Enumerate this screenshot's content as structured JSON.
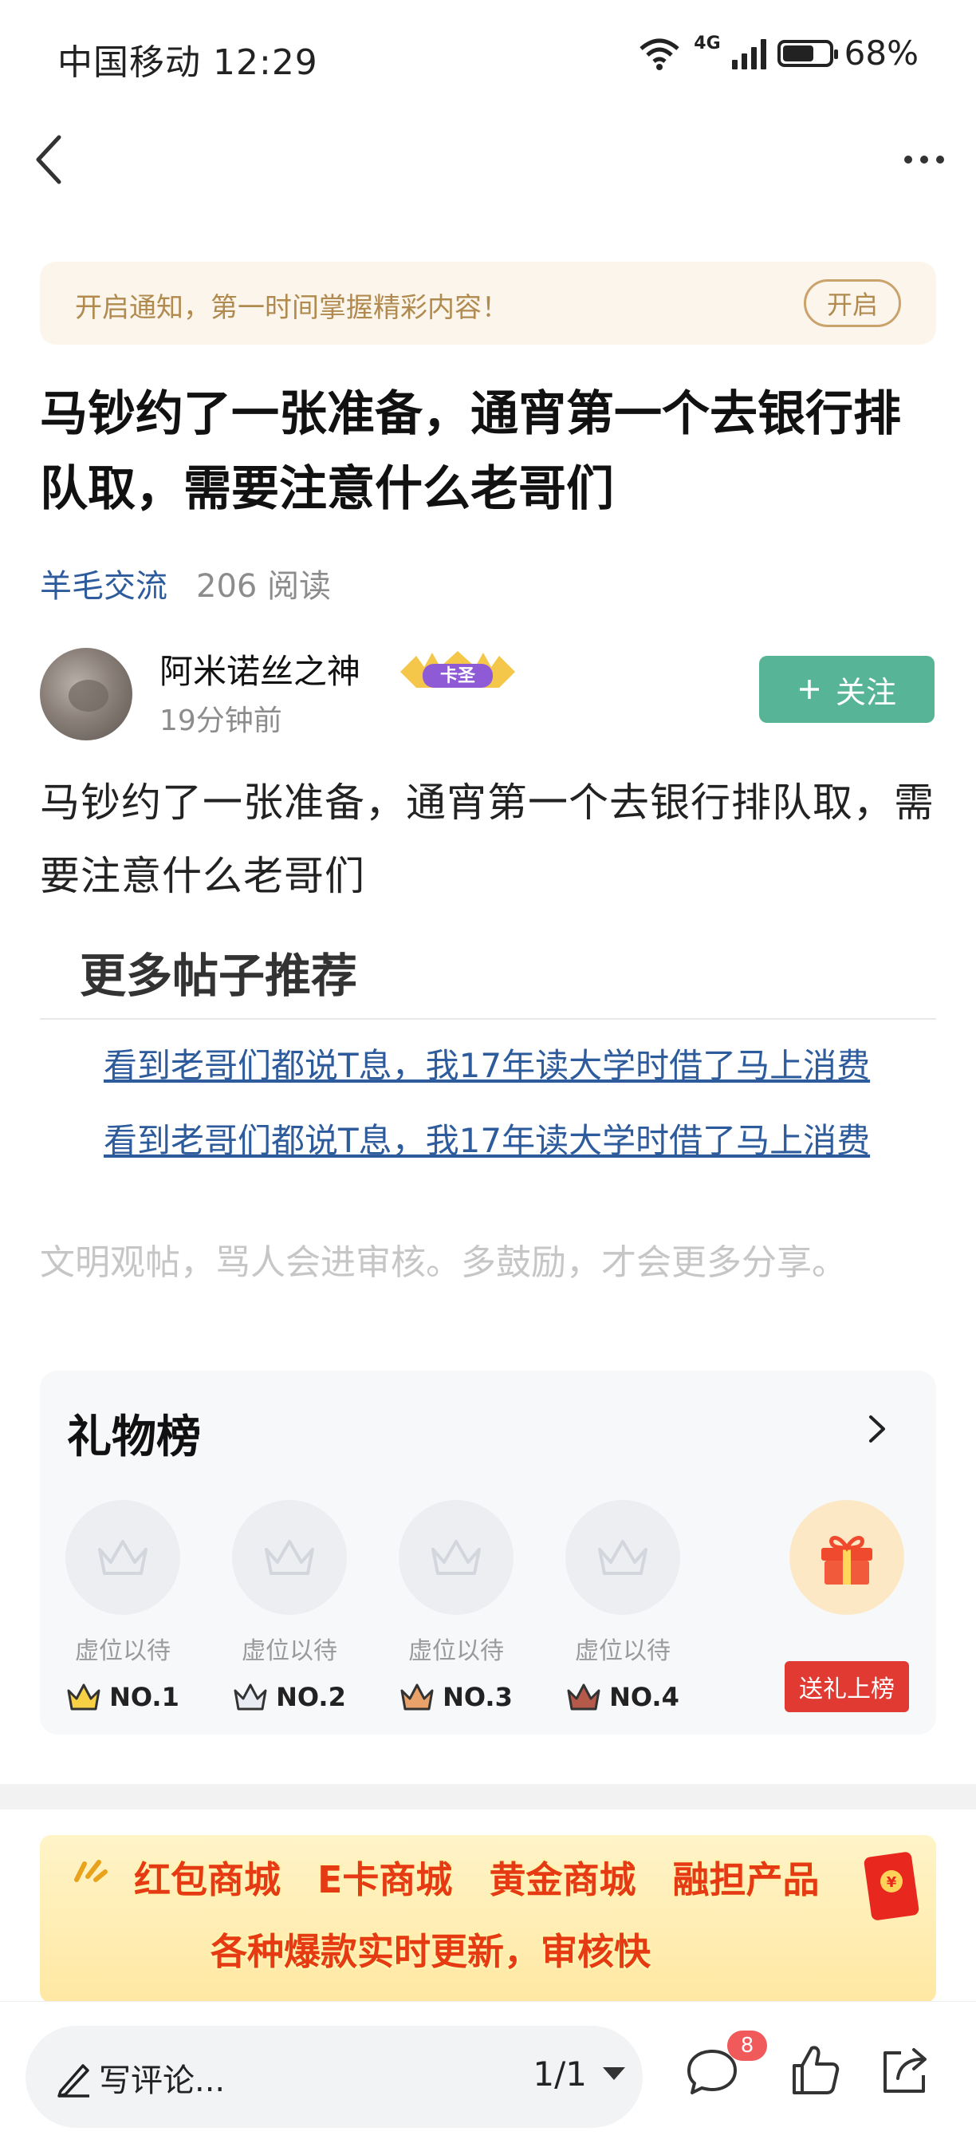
{
  "status_bar": {
    "carrier": "中国移动",
    "time": "12:29",
    "network": "4G",
    "battery": "68%",
    "battery_level": 0.68
  },
  "nav": {
    "back_icon": "chevron-left-icon",
    "more_icon": "more-dots-icon"
  },
  "notice": {
    "text": "开启通知，第一时间掌握精彩内容！",
    "button": "开启"
  },
  "post": {
    "title": "马钞约了一张准备，通宵第一个去银行排队取，需要注意什么老哥们",
    "category": "羊毛交流",
    "reads": "206 阅读",
    "author": {
      "name": "阿米诺丝之神",
      "badge": "卡圣",
      "time": "19分钟前"
    },
    "follow_label": "关注",
    "body": "马钞约了一张准备，通宵第一个去银行排队取，需要注意什么老哥们"
  },
  "recommend": {
    "title": "更多帖子推荐",
    "links": [
      "看到老哥们都说T息，我17年读大学时借了马上消费",
      "看到老哥们都说T息，我17年读大学时借了马上消费"
    ]
  },
  "civility_note": "文明观帖，骂人会进审核。多鼓励，才会更多分享。",
  "gift_board": {
    "title": "礼物榜",
    "slots": [
      {
        "label": "虚位以待",
        "rank": "NO.1"
      },
      {
        "label": "虚位以待",
        "rank": "NO.2"
      },
      {
        "label": "虚位以待",
        "rank": "NO.3"
      },
      {
        "label": "虚位以待",
        "rank": "NO.4"
      }
    ],
    "send_button": "送礼上榜"
  },
  "banner": {
    "items": [
      "红包商城",
      "E卡商城",
      "黄金商城",
      "融担产品"
    ],
    "slogan": "各种爆款实时更新，审核快"
  },
  "bottom_bar": {
    "comment_placeholder": "写评论...",
    "page": "1/1",
    "comment_count": "8"
  },
  "colors": {
    "link": "#2d5b9b",
    "follow": "#57b496",
    "send": "#e03a32",
    "notice_bg": "#fbf5ec"
  }
}
